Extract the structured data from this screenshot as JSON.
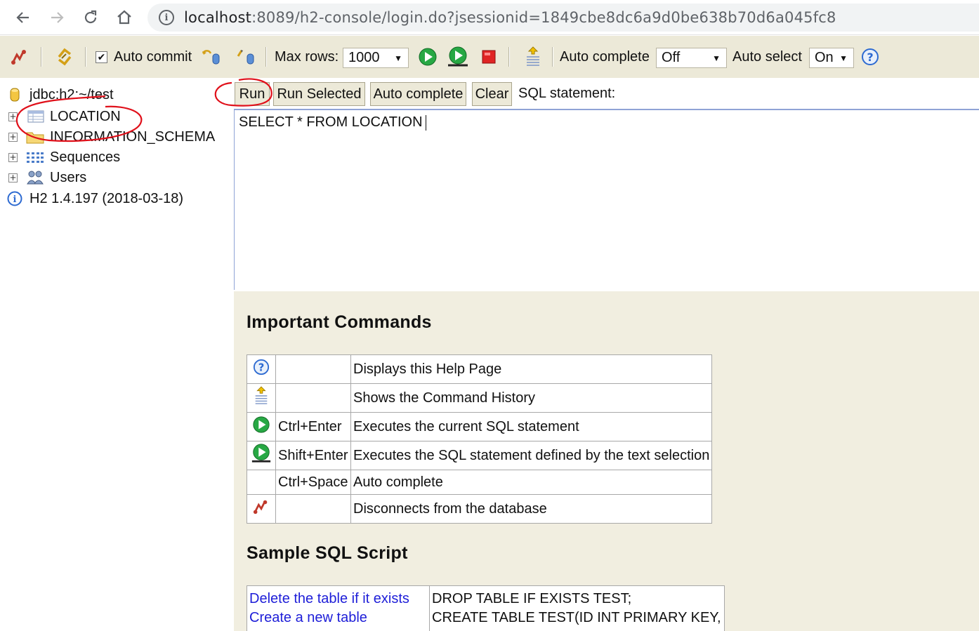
{
  "browser": {
    "url_host": "localhost",
    "url_rest": ":8089/h2-console/login.do?jsessionid=1849cbe8dc6a9d0be638b70d6a045fc8"
  },
  "toolbar": {
    "auto_commit_label": "Auto commit",
    "auto_commit_checked": true,
    "max_rows_label": "Max rows:",
    "max_rows_value": "1000",
    "auto_complete_label": "Auto complete",
    "auto_complete_value": "Off",
    "auto_select_label": "Auto select",
    "auto_select_value": "On"
  },
  "tree": {
    "connection": "jdbc:h2:~/test",
    "items": [
      {
        "label": "LOCATION",
        "icon": "table-icon"
      },
      {
        "label": "INFORMATION_SCHEMA",
        "icon": "folder-icon"
      },
      {
        "label": "Sequences",
        "icon": "sequences-icon"
      },
      {
        "label": "Users",
        "icon": "users-icon"
      }
    ],
    "version": "H2 1.4.197 (2018-03-18)"
  },
  "buttons": {
    "run": "Run",
    "run_selected": "Run Selected",
    "auto_complete": "Auto complete",
    "clear": "Clear",
    "sql_statement_label": "SQL statement:"
  },
  "editor": {
    "sql": "SELECT * FROM LOCATION"
  },
  "help": {
    "important_title": "Important Commands",
    "commands": [
      {
        "icon": "help-icon",
        "key": "",
        "desc": "Displays this Help Page"
      },
      {
        "icon": "history-icon",
        "key": "",
        "desc": "Shows the Command History"
      },
      {
        "icon": "run-icon",
        "key": "Ctrl+Enter",
        "desc": "Executes the current SQL statement"
      },
      {
        "icon": "run-selected-icon",
        "key": "Shift+Enter",
        "desc": "Executes the SQL statement defined by the text selection"
      },
      {
        "icon": "",
        "key": "Ctrl+Space",
        "desc": "Auto complete"
      },
      {
        "icon": "disconnect-icon",
        "key": "",
        "desc": "Disconnects from the database"
      }
    ],
    "sample_title": "Sample SQL Script",
    "sample_links": [
      "Delete the table if it exists",
      "Create a new table"
    ],
    "sample_code": [
      "DROP TABLE IF EXISTS TEST;",
      "CREATE TABLE TEST(ID INT PRIMARY KEY,"
    ]
  },
  "colors": {
    "toolbar_bg": "#ece9d8",
    "help_bg": "#f1eee0",
    "link": "#1d1dd8",
    "annotation": "#e0101a"
  }
}
